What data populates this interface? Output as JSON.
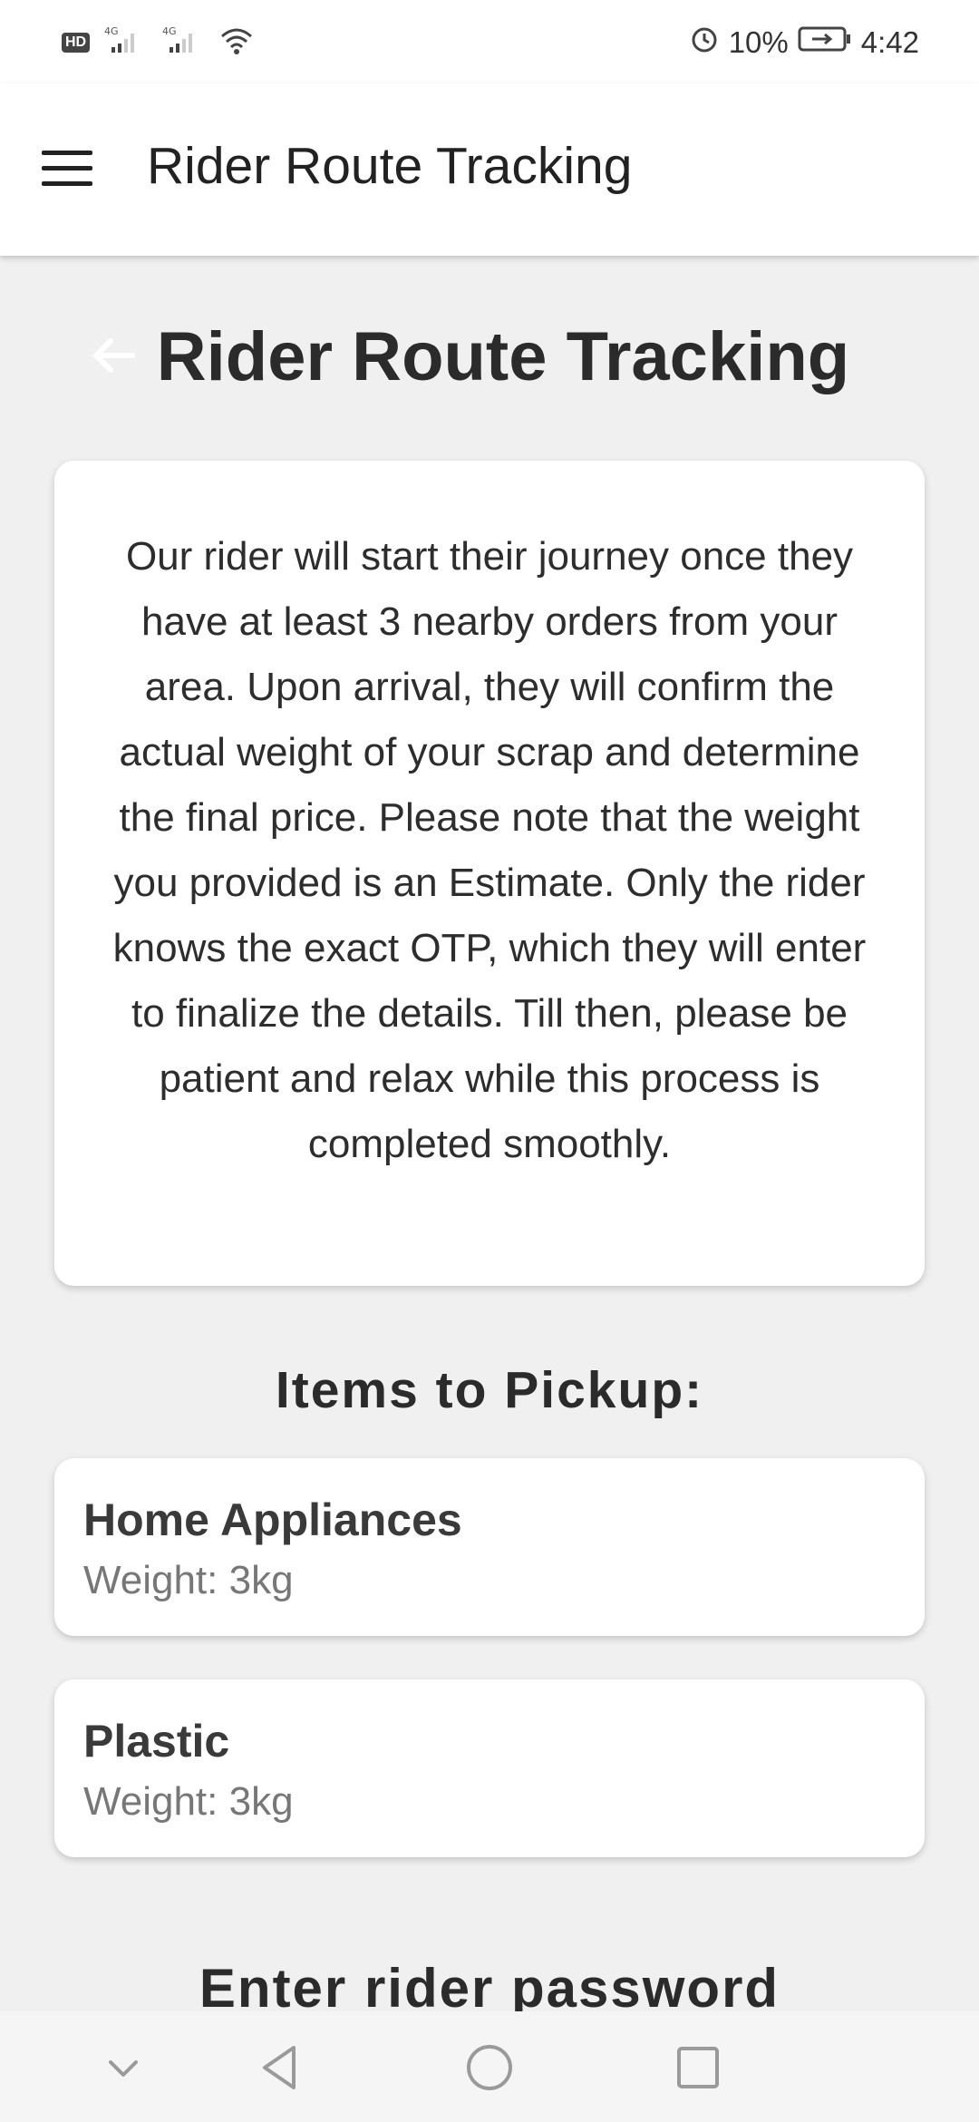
{
  "status_bar": {
    "left_badge": "HD",
    "network1": "4G",
    "network2": "4G",
    "battery": "10%",
    "time": "4:42"
  },
  "app_bar": {
    "title": "Rider Route Tracking"
  },
  "page": {
    "title": "Rider Route Tracking",
    "info_text": "Our rider will start their journey once they have at least 3 nearby orders from your area. Upon arrival, they will confirm the actual weight of your scrap and determine the final price. Please note that the weight you provided is an Estimate. Only the rider knows the exact OTP, which they will enter to finalize the details. Till then, please be patient and relax while this process is completed smoothly."
  },
  "pickup": {
    "heading": "Items to Pickup:",
    "items": [
      {
        "name": "Home Appliances",
        "weight": "Weight: 3kg"
      },
      {
        "name": "Plastic",
        "weight": "Weight: 3kg"
      }
    ]
  },
  "password": {
    "label": "Enter rider password"
  },
  "icons": {
    "menu": "hamburger-menu-icon",
    "back": "back-arrow-icon",
    "nav_down": "chevron-down-icon",
    "nav_back": "triangle-back-icon",
    "nav_home": "circle-home-icon",
    "nav_recent": "square-recent-icon"
  }
}
